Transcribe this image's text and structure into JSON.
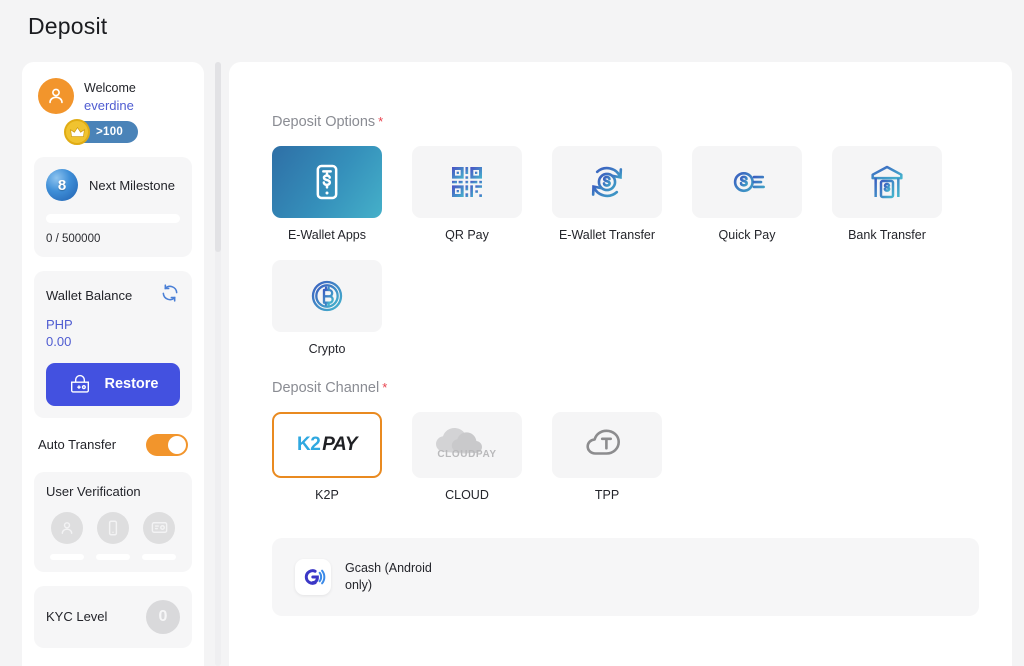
{
  "page": {
    "title": "Deposit"
  },
  "sidebar": {
    "welcome": {
      "greeting": "Welcome",
      "username": "everdine",
      "rank_badge": ">100",
      "avatar_icon": "user-avatar-icon",
      "crown_icon": "crown-icon"
    },
    "milestone": {
      "title": "Next Milestone",
      "orb_label": "8",
      "progress_text": "0 / 500000",
      "progress_percent": 0
    },
    "wallet": {
      "title": "Wallet Balance",
      "currency": "PHP",
      "amount": "0.00",
      "refresh_icon": "refresh-icon",
      "restore_label": "Restore",
      "restore_icon": "wallet-restore-icon"
    },
    "auto_transfer": {
      "label": "Auto Transfer",
      "enabled": true
    },
    "user_verification": {
      "title": "User Verification",
      "items": [
        {
          "icon": "person-icon"
        },
        {
          "icon": "phone-icon"
        },
        {
          "icon": "id-card-icon"
        }
      ]
    },
    "kyc": {
      "label": "KYC Level",
      "level": "0"
    }
  },
  "main": {
    "deposit_options": {
      "label": "Deposit Options",
      "required_marker": "*",
      "items": [
        {
          "name": "E-Wallet Apps",
          "icon": "phone-dollar-icon",
          "selected": true
        },
        {
          "name": "QR Pay",
          "icon": "qr-code-icon",
          "selected": false
        },
        {
          "name": "E-Wallet Transfer",
          "icon": "dollar-refresh-icon",
          "selected": false
        },
        {
          "name": "Quick Pay",
          "icon": "fast-dollar-icon",
          "selected": false
        },
        {
          "name": "Bank Transfer",
          "icon": "bank-icon",
          "selected": false
        },
        {
          "name": "Crypto",
          "icon": "bitcoin-icon",
          "selected": false
        }
      ]
    },
    "deposit_channel": {
      "label": "Deposit Channel",
      "required_marker": "*",
      "items": [
        {
          "name": "K2P",
          "logo": "k2pay-logo",
          "logo_k": "K",
          "logo_2": "2",
          "logo_pay": "PAY",
          "selected": true
        },
        {
          "name": "CLOUD",
          "logo": "cloudpay-logo",
          "logo_text": "CLOUDPAY",
          "selected": false
        },
        {
          "name": "TPP",
          "logo": "tpp-logo",
          "selected": false
        }
      ]
    },
    "provider": {
      "name": "Gcash (Android only)",
      "icon": "gcash-icon"
    }
  },
  "colors": {
    "accent_blue": "#4351e0",
    "accent_orange": "#f2952c",
    "selected_border": "#e98a20",
    "link_blue": "#4f5cd1",
    "required_red": "#e8424e"
  }
}
